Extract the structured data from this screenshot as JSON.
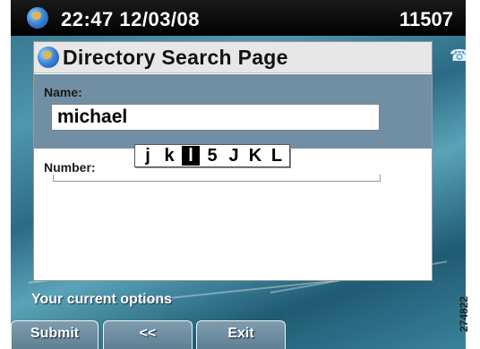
{
  "status_bar": {
    "datetime": "22:47 12/03/08",
    "extension": "11507"
  },
  "page": {
    "title": "Directory Search Page",
    "name_label": "Name:",
    "name_value": "michael",
    "number_label": "Number:"
  },
  "char_picker": {
    "options": [
      "j",
      "k",
      "l",
      "5",
      "J",
      "K",
      "L"
    ],
    "selected_index": 2
  },
  "options_label": "Your current options",
  "softkeys": [
    "Submit",
    "<<",
    "Exit"
  ],
  "side_marker": "274822",
  "icons": {
    "status": "globe-icon",
    "title": "globe-icon",
    "right": "phone-icon"
  },
  "colors": {
    "statusbar": "#000000",
    "name_section": "#718fa4",
    "selected_char": "#000000",
    "softkey": "#6f8ea2"
  }
}
